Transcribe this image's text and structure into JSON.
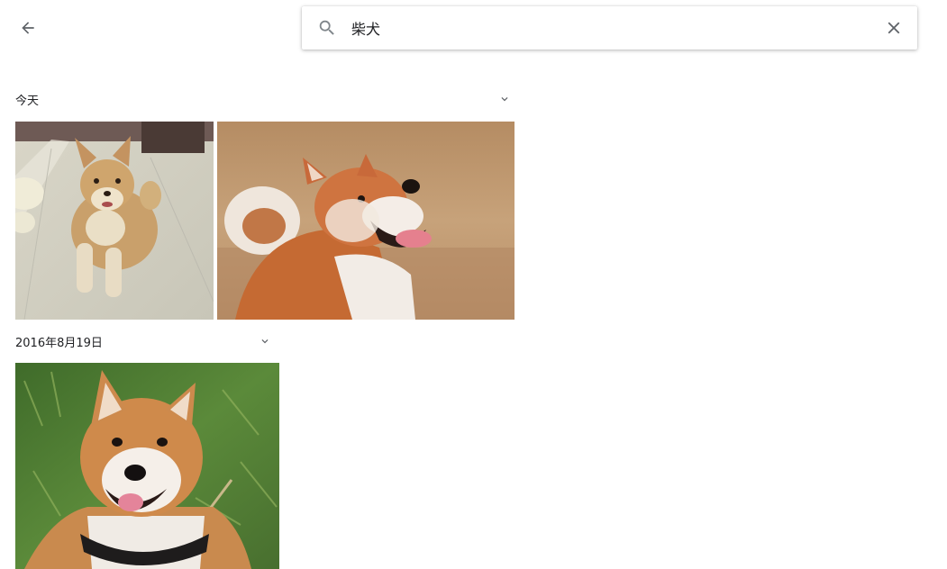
{
  "header": {
    "back_icon": "arrow-back-icon",
    "search_icon": "search-icon",
    "clear_icon": "close-icon"
  },
  "search": {
    "query": "柴犬",
    "placeholder": ""
  },
  "sections": [
    {
      "title": "今天",
      "toggle_icon": "chevron-down-icon",
      "photos": [
        {
          "subject": "shiba-lying-on-tile-floor"
        },
        {
          "subject": "shiba-looking-up-in-field"
        }
      ]
    },
    {
      "title": "2016年8月19日",
      "toggle_icon": "chevron-down-icon",
      "photos": [
        {
          "subject": "shiba-smiling-in-grass"
        }
      ]
    }
  ],
  "colors": {
    "icon": "#5f6368",
    "text": "#202124"
  }
}
